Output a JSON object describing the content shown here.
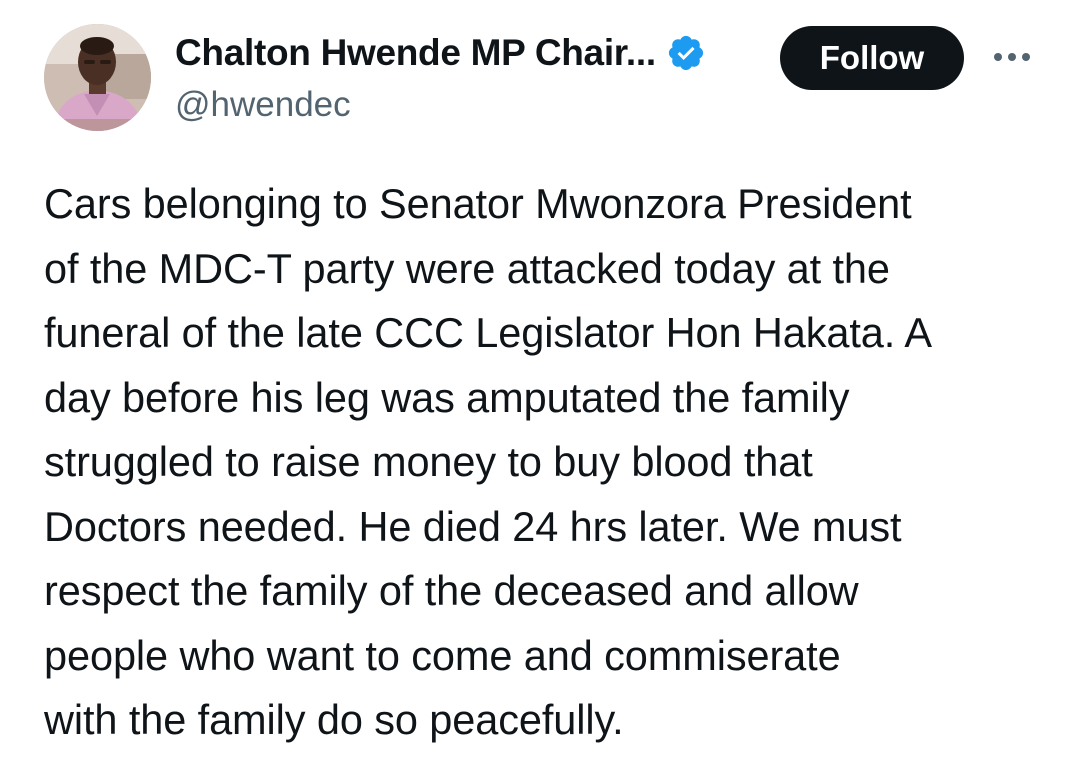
{
  "author": {
    "display_name": "Chalton Hwende MP Chair...",
    "handle": "@hwendec",
    "verified_color": "#1d9bf0"
  },
  "actions": {
    "follow_label": "Follow",
    "more_icon": "more-horizontal-icon"
  },
  "tweet": {
    "lines": [
      "Cars belonging to Senator Mwonzora President",
      "of the MDC-T party were attacked today at the",
      "funeral of the late CCC Legislator Hon Hakata. A",
      "day before his leg was amputated the family",
      "struggled to raise money to buy blood that",
      "Doctors needed. He died 24 hrs later. We must",
      "respect the family of the deceased and allow",
      "people who want to come and commiserate",
      "with the family do so peacefully."
    ]
  }
}
